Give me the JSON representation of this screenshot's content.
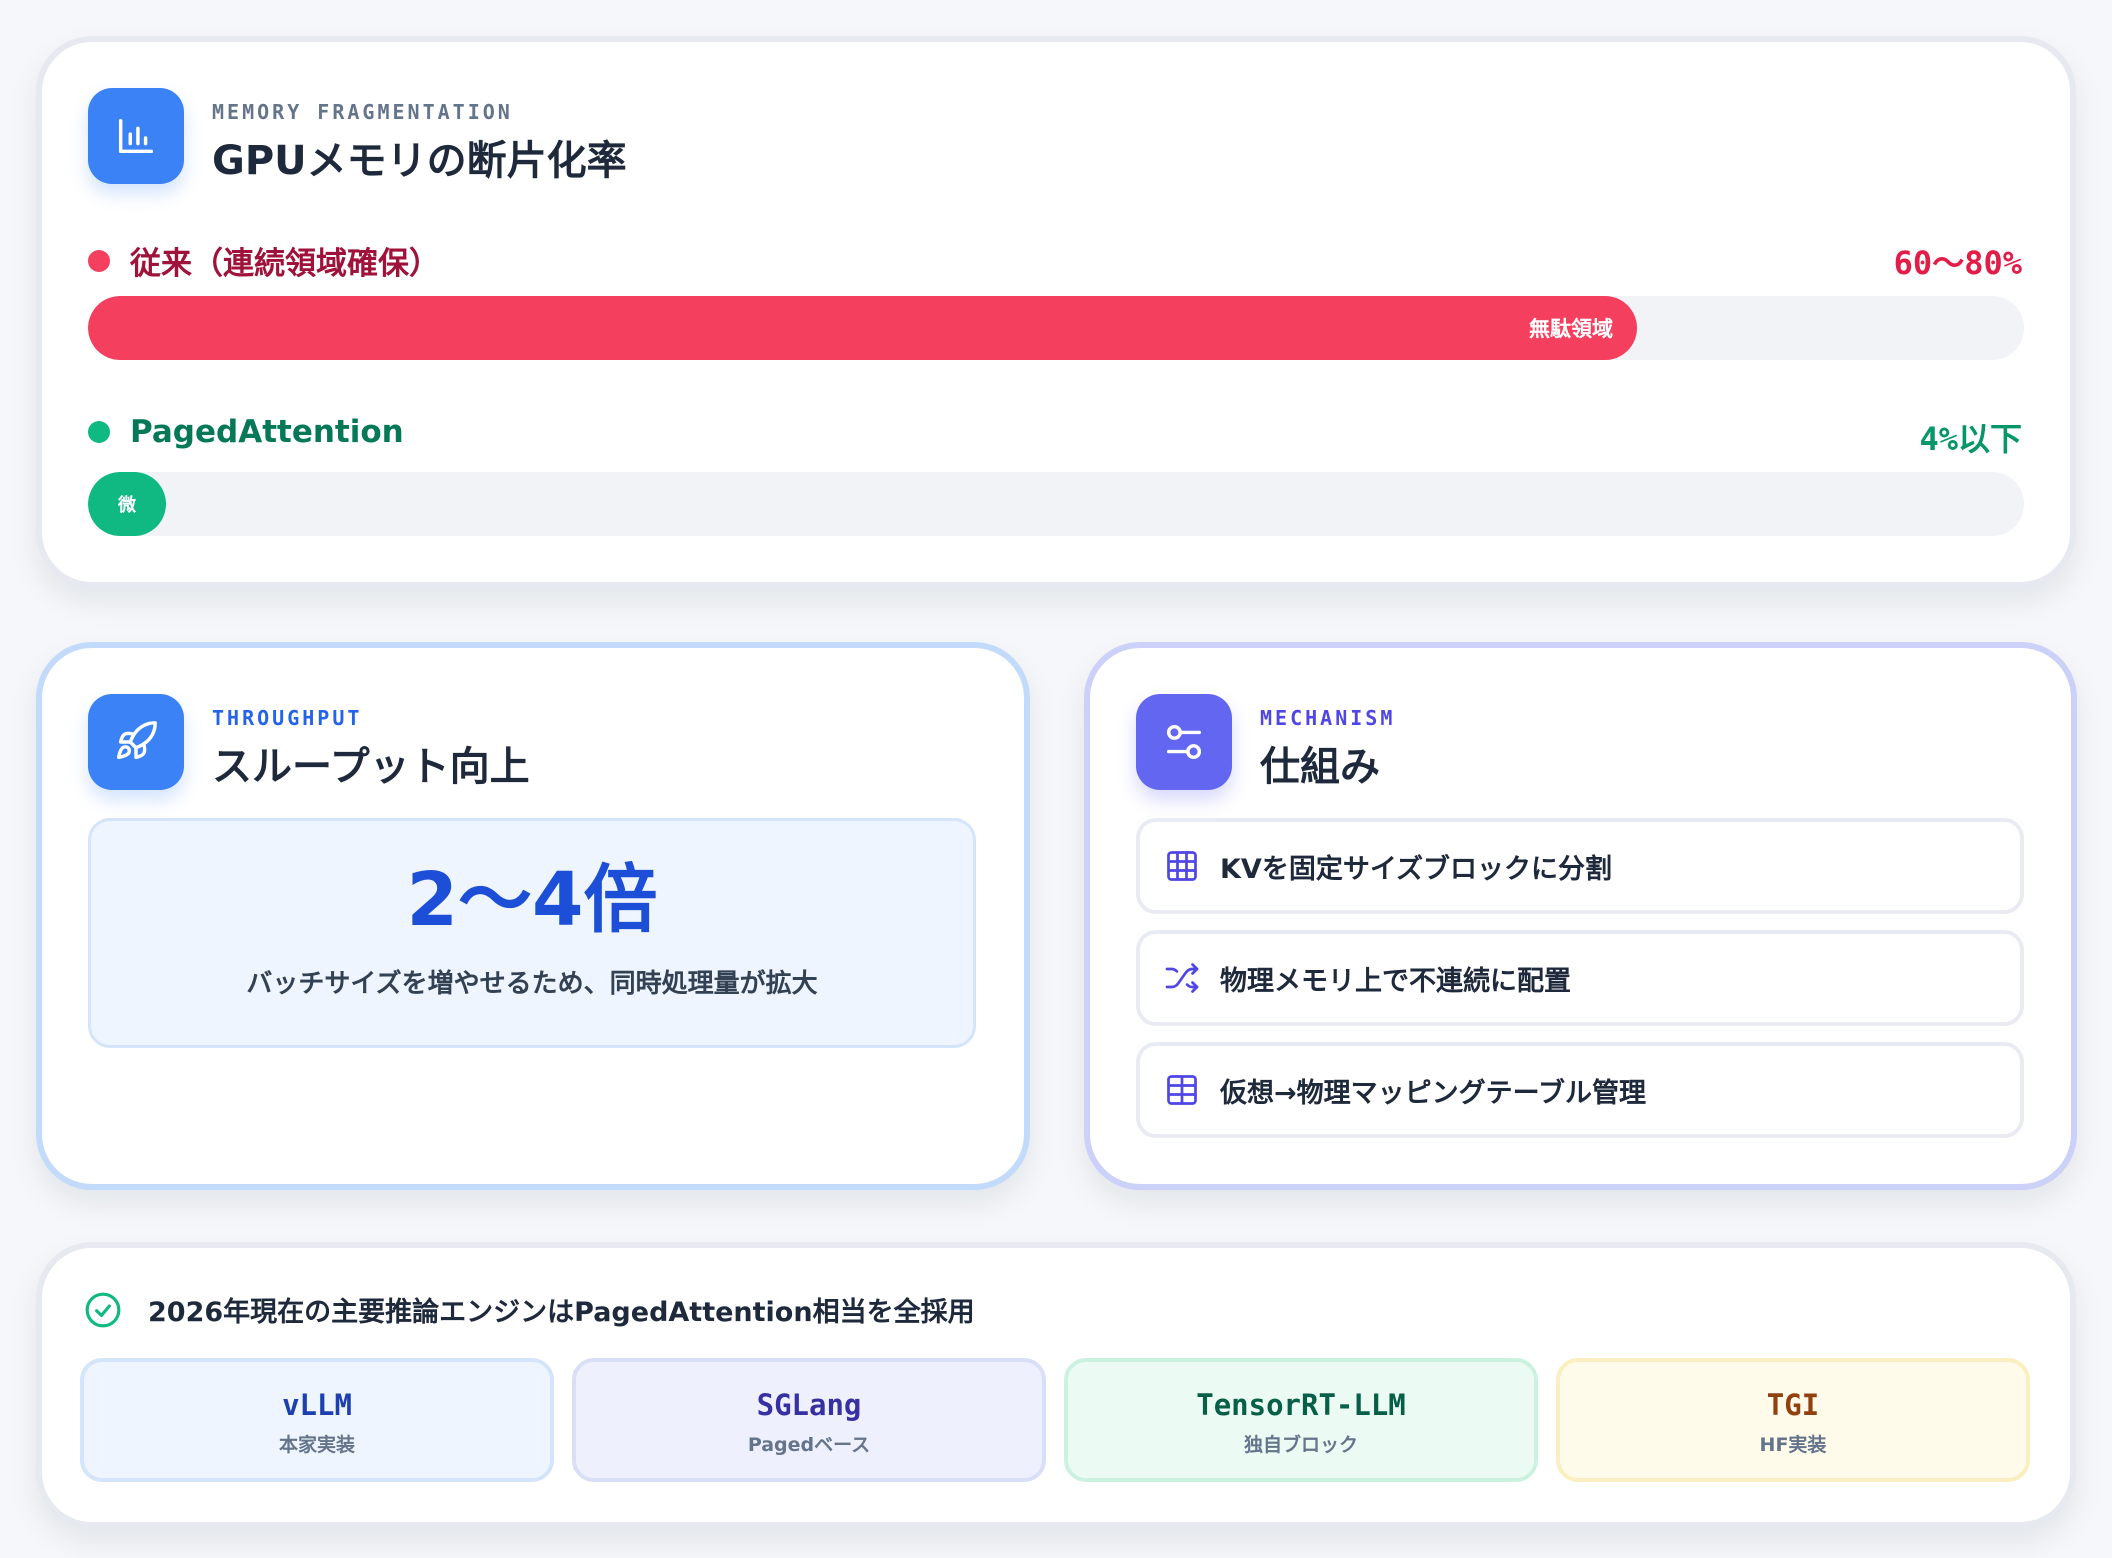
{
  "fragmentation": {
    "eyebrow": "MEMORY FRAGMENTATION",
    "title": "GPUメモリの断片化率",
    "icon": "bar-chart-icon",
    "rows": [
      {
        "label": "従来（連続領域確保）",
        "value": "60〜80%",
        "bar_label": "無駄領域",
        "fill_fraction": 0.8,
        "color": "#f43f5e",
        "text_color": "#9f1239"
      },
      {
        "label": "PagedAttention",
        "value": "4%以下",
        "bar_label": "微",
        "fill_fraction": 0.04,
        "color": "#10b981",
        "text_color": "#047857"
      }
    ]
  },
  "throughput": {
    "eyebrow": "THROUGHPUT",
    "title": "スループット向上",
    "icon": "rocket-icon",
    "value": "2〜4倍",
    "caption": "バッチサイズを増やせるため、同時処理量が拡大"
  },
  "mechanism": {
    "eyebrow": "MECHANISM",
    "title": "仕組み",
    "icon": "settings-toggle-icon",
    "items": [
      {
        "icon": "grid-icon",
        "text": "KVを固定サイズブロックに分割"
      },
      {
        "icon": "shuffle-icon",
        "text": "物理メモリ上で不連続に配置"
      },
      {
        "icon": "table-icon",
        "text": "仮想→物理マッピングテーブル管理"
      }
    ]
  },
  "engines": {
    "icon": "check-circle-icon",
    "title": "2026年現在の主要推論エンジンはPagedAttention相当を全採用",
    "items": [
      {
        "name": "vLLM",
        "sub": "本家実装",
        "bg": "#eef5fe",
        "border": "#d4e5fb",
        "name_color": "#1e40af"
      },
      {
        "name": "SGLang",
        "sub": "Pagedベース",
        "bg": "#eef1fd",
        "border": "#dadff8",
        "name_color": "#3730a3"
      },
      {
        "name": "TensorRT-LLM",
        "sub": "独自ブロック",
        "bg": "#ebfbf3",
        "border": "#cbf2df",
        "name_color": "#065f46"
      },
      {
        "name": "TGI",
        "sub": "HF実装",
        "bg": "#fefbeb",
        "border": "#fbeec0",
        "name_color": "#92400e"
      }
    ]
  }
}
